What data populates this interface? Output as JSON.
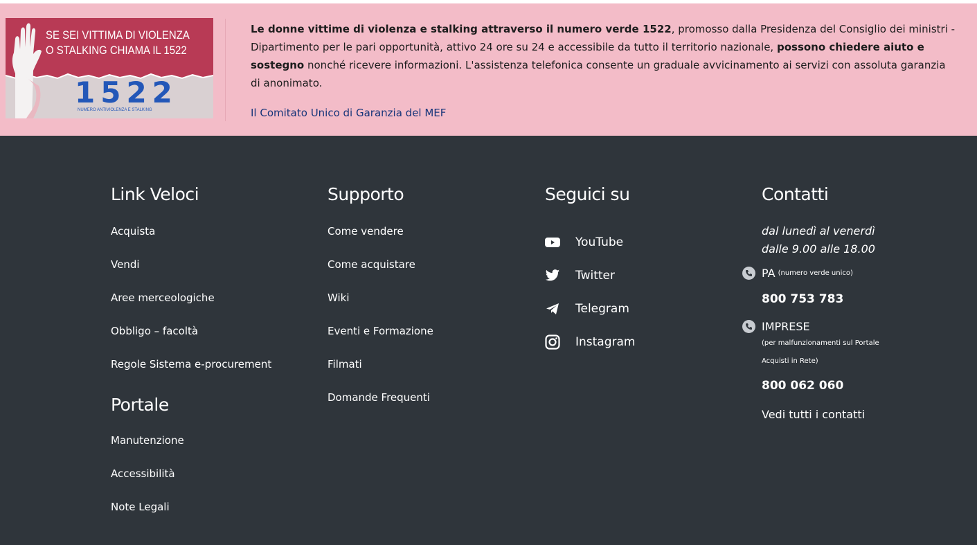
{
  "banner": {
    "image": {
      "title_line1": "SE SEI VITTIMA DI VIOLENZA",
      "title_line2": "O STALKING CHIAMA IL 1522",
      "big_number": "1522",
      "subtitle": "NUMERO ANTIVIOLENZA E STALKING"
    },
    "text_bold1": "Le donne vittime di violenza e stalking attraverso il numero verde 1522",
    "text_part2": ", promosso dalla Presidenza del Consiglio dei ministri - Dipartimento per le pari opportunità, attivo 24 ore su 24 e accessibile da tutto il territorio nazionale, ",
    "text_bold2": "possono chiedere aiuto e sostegno",
    "text_part3": " nonché ricevere informazioni. L'assistenza telefonica consente un graduale avvicinamento ai servizi con assoluta garanzia di anonimato.",
    "link": "Il Comitato Unico di Garanzia del MEF",
    "colors": {
      "background": "#f3bcc8",
      "link": "#16357a"
    }
  },
  "footer": {
    "background": "#2f353b",
    "quick_links": {
      "title": "Link Veloci",
      "items": [
        "Acquista",
        "Vendi",
        "Aree merceologiche",
        "Obbligo – facoltà",
        "Regole Sistema e-procurement"
      ]
    },
    "portal": {
      "title": "Portale",
      "items": [
        "Manutenzione",
        "Accessibilità",
        "Note Legali"
      ]
    },
    "support": {
      "title": "Supporto",
      "items": [
        "Come vendere",
        "Come acquistare",
        "Wiki",
        "Eventi e Formazione",
        "Filmati",
        "Domande Frequenti"
      ]
    },
    "social": {
      "title": "Seguici su",
      "items": [
        {
          "label": "YouTube",
          "icon": "youtube-icon"
        },
        {
          "label": "Twitter",
          "icon": "twitter-icon"
        },
        {
          "label": "Telegram",
          "icon": "telegram-icon"
        },
        {
          "label": "Instagram",
          "icon": "instagram-icon"
        }
      ]
    },
    "contacts": {
      "title": "Contatti",
      "hours_line1": "dal lunedì al venerdì",
      "hours_line2": "dalle 9.00 alle 18.00",
      "pa_label": "PA",
      "pa_note": "(numero verde unico)",
      "pa_number": "800 753 783",
      "imprese_label": "IMPRESE",
      "imprese_note_line1": "(per malfunzionamenti sul Portale",
      "imprese_note_line2": "Acquisti in Rete)",
      "imprese_number": "800 062 060",
      "all_contacts": "Vedi tutti i contatti",
      "phone_icon": "phone-icon"
    }
  }
}
